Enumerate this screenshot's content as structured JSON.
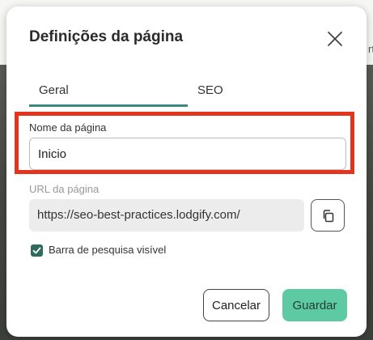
{
  "dialog": {
    "title": "Definições da página",
    "close_icon": "close-icon"
  },
  "tabs": [
    {
      "label": "Geral",
      "active": true
    },
    {
      "label": "SEO",
      "active": false
    }
  ],
  "page_name": {
    "label": "Nome da página",
    "value": "Inicio"
  },
  "page_url": {
    "label": "URL da página",
    "value": "https://seo-best-practices.lodgify.com/",
    "copy_icon": "copy-icon"
  },
  "search_bar": {
    "label": "Barra de pesquisa visível",
    "checked": true
  },
  "buttons": {
    "cancel": "Cancelar",
    "save": "Guardar"
  },
  "colors": {
    "accent": "#3a8a80",
    "highlight": "#e3341d",
    "save_button": "#5dcaa3",
    "checkbox": "#2f6b5c"
  }
}
